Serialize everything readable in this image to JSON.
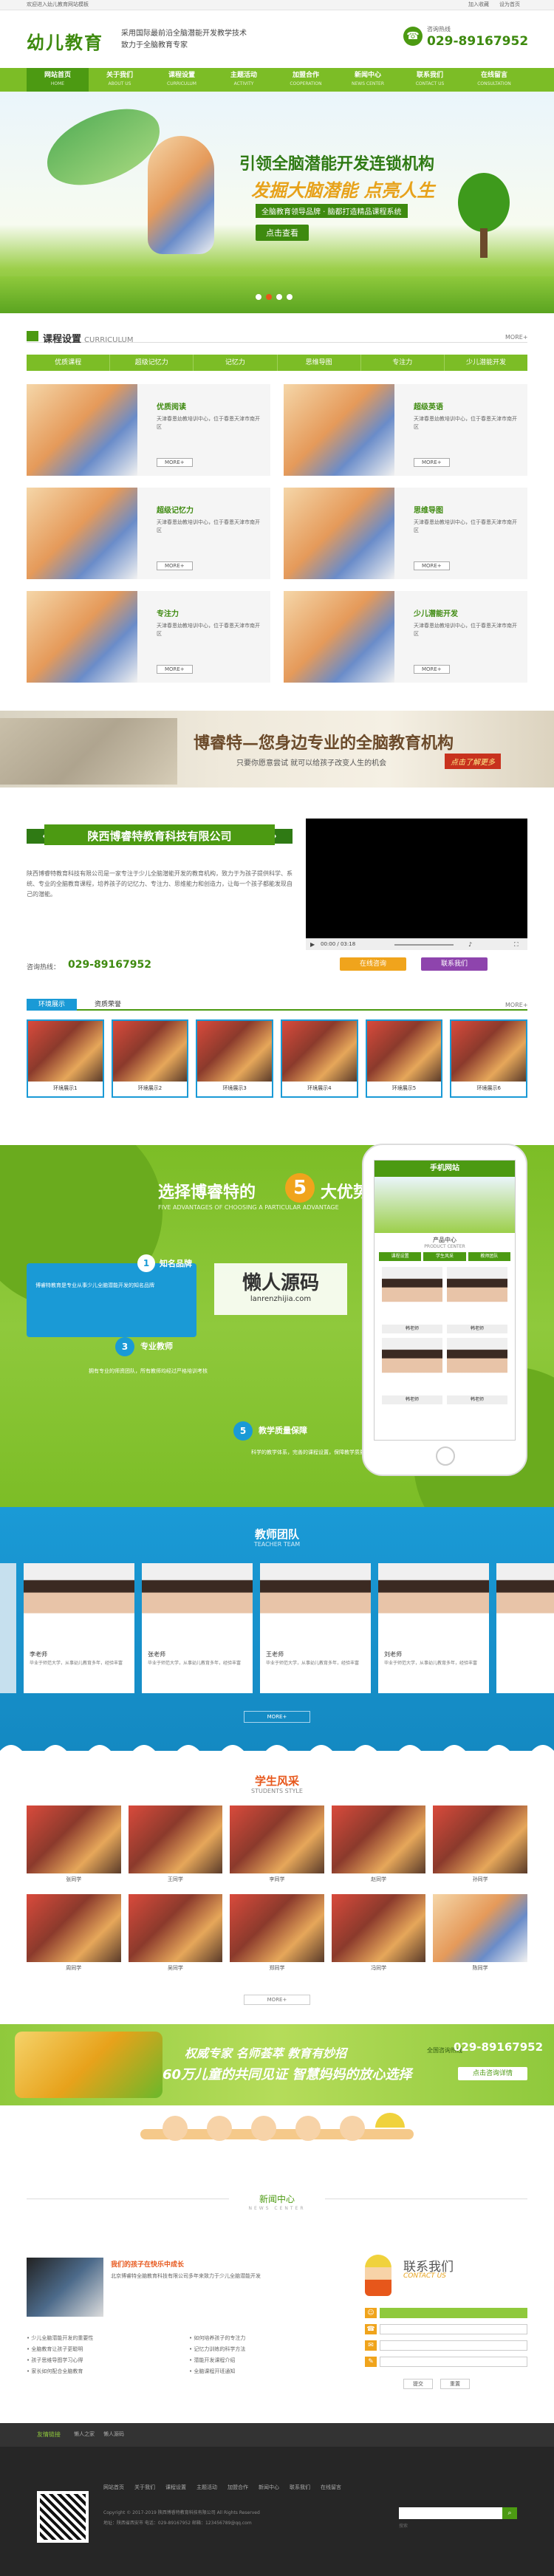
{
  "topbar": {
    "left": "欢迎进入幼儿教育网站模板",
    "right1": "加入收藏",
    "right2": "设为首页"
  },
  "header": {
    "logo": "幼儿教育",
    "slogan1": "采用国际最前沿全脑潜能开发教学技术",
    "slogan2": "致力于全脑教育专家",
    "hotline_label": "咨询热线",
    "phone": "029-89167952"
  },
  "nav": [
    {
      "cn": "网站首页",
      "en": "HOME"
    },
    {
      "cn": "关于我们",
      "en": "ABOUT US"
    },
    {
      "cn": "课程设置",
      "en": "CURRICULUM"
    },
    {
      "cn": "主题活动",
      "en": "ACTIVITY"
    },
    {
      "cn": "加盟合作",
      "en": "COOPERATION"
    },
    {
      "cn": "新闻中心",
      "en": "NEWS CENTER"
    },
    {
      "cn": "联系我们",
      "en": "CONTACT US"
    },
    {
      "cn": "在线留言",
      "en": "CONSULTATION"
    }
  ],
  "banner": {
    "line1": "引领全脑潜能开发连锁机构",
    "line2": "发掘大脑潜能 点亮人生",
    "line3": "全脑教育领导品牌 · 脑都打造精品课程系统",
    "btn": "点击查看"
  },
  "curriculum": {
    "title": "课程设置",
    "en": "CURRICULUM",
    "more": "MORE+",
    "tabs": [
      "优质课程",
      "超级记忆力",
      "记忆力",
      "思维导图",
      "专注力",
      "少儿潜能开发"
    ],
    "items": [
      {
        "title": "优质阅读",
        "desc": "天津春恩幼教培训中心，位于春恩天津市南开区",
        "btn": "MORE+"
      },
      {
        "title": "超级英语",
        "desc": "天津春恩幼教培训中心，位于春恩天津市南开区",
        "btn": "MORE+"
      },
      {
        "title": "超级记忆力",
        "desc": "天津春恩幼教培训中心，位于春恩天津市南开区",
        "btn": "MORE+"
      },
      {
        "title": "思维导图",
        "desc": "天津春恩幼教培训中心，位于春恩天津市南开区",
        "btn": "MORE+"
      },
      {
        "title": "专注力",
        "desc": "天津春恩幼教培训中心，位于春恩天津市南开区",
        "btn": "MORE+"
      },
      {
        "title": "少儿潜能开发",
        "desc": "天津春恩幼教培训中心，位于春恩天津市南开区",
        "btn": "MORE+"
      }
    ]
  },
  "promo": {
    "title": "博睿特—您身边专业的全脑教育机构",
    "sub": "只要你愿意尝试 就可以给孩子改变人生的机会",
    "btn": "点击了解更多"
  },
  "about": {
    "ribbon": "陕西博睿特教育科技有限公司",
    "text": "陕西博睿特教育科技有限公司是一家专注于少儿全脑潜能开发的教育机构，致力于为孩子提供科学、系统、专业的全脑教育课程，培养孩子的记忆力、专注力、思维能力和创造力，让每一个孩子都能发现自己的潜能。",
    "phone_label": "咨询热线：",
    "phone": "029-89167952",
    "time": "00:00 / 03:18",
    "btn1": "在线咨询",
    "btn2": "联系我们"
  },
  "env": {
    "tab1": "环境展示",
    "tab2": "资质荣誉",
    "more": "MORE+",
    "items": [
      "环境展示1",
      "环境展示2",
      "环境展示3",
      "环境展示4",
      "环境展示5",
      "环境展示6"
    ]
  },
  "reasons": {
    "title": "选择博睿特的",
    "num": "5",
    "suffix": "大优势",
    "en": "FIVE ADVANTAGES OF CHOOSING A PARTICULAR ADVANTAGE",
    "r1": "知名品牌",
    "r1_text": "博睿特教育是专业从事少儿全脑潜能开发的知名品牌",
    "r3": "专业教师",
    "r3_text": "拥有专业的师资团队，所有教师均经过严格培训考核",
    "r5": "教学质量保障",
    "r5_text": "科学的教学体系，完善的课程设置，保障教学质量"
  },
  "phone_mock": {
    "title": "手机网站",
    "product_cn": "产品中心",
    "product_en": "PRODUCT CENTER",
    "tab1": "课程设置",
    "tab2": "学生风采",
    "tab3": "教师团队",
    "captions": [
      "韩老师",
      "韩老师",
      "韩老师",
      "韩老师"
    ]
  },
  "watermark": {
    "cn": "懒人源码",
    "en": "lanrenzhijia.com"
  },
  "teachers": {
    "title": "教师团队",
    "en": "TEACHER TEAM",
    "more": "MORE+",
    "items": [
      {
        "name": "李老师",
        "desc": "毕业于师范大学，从事幼儿教育多年，经验丰富"
      },
      {
        "name": "张老师",
        "desc": "毕业于师范大学，从事幼儿教育多年，经验丰富"
      },
      {
        "name": "王老师",
        "desc": "毕业于师范大学，从事幼儿教育多年，经验丰富"
      },
      {
        "name": "刘老师",
        "desc": "毕业于师范大学，从事幼儿教育多年，经验丰富"
      }
    ]
  },
  "students": {
    "title": "学生风采",
    "en": "STUDENTS STYLE",
    "more": "MORE+",
    "items": [
      "张同学",
      "王同学",
      "李同学",
      "赵同学",
      "孙同学",
      "周同学",
      "吴同学",
      "郑同学",
      "冯同学",
      "陈同学"
    ]
  },
  "banner2": {
    "line1": "权威专家 名师荟萃 教育有妙招",
    "line2": "60万儿童的共同见证 智慧妈妈的放心选择",
    "hotline": "全国咨询热线",
    "phone": "029-89167952",
    "btn": "点击咨询详情"
  },
  "news": {
    "title": "新闻中心",
    "en": "NEWS CENTER",
    "headline": "我们的孩子在快乐中成长",
    "headline_text": "北京博睿特全脑教育科技有限公司多年来致力于少儿全脑潜能开发",
    "list": [
      "少儿全脑潜能开发的重要性",
      "如何培养孩子的专注力",
      "全脑教育让孩子更聪明",
      "记忆力训练的科学方法",
      "孩子思维导图学习心得",
      "潜能开发课程介绍",
      "家长如何配合全脑教育",
      "全脑课程开班通知"
    ]
  },
  "contact": {
    "title": "联系我们",
    "en": "CONTACT US",
    "btn1": "提交",
    "btn2": "重置"
  },
  "links": {
    "label": "友情链接",
    "items": [
      "懒人之家",
      "懒人源码"
    ]
  },
  "footer": {
    "nav": [
      "网站首页",
      "关于我们",
      "课程设置",
      "主题活动",
      "加盟合作",
      "新闻中心",
      "联系我们",
      "在线留言"
    ],
    "copy": "Copyright © 2017-2019 陕西博睿特教育科技有限公司 All Rights Reserved",
    "addr": "地址：陕西省西安市 电话：029-89167952 邮箱：123456789@qq.com",
    "search_btn": "搜索"
  }
}
